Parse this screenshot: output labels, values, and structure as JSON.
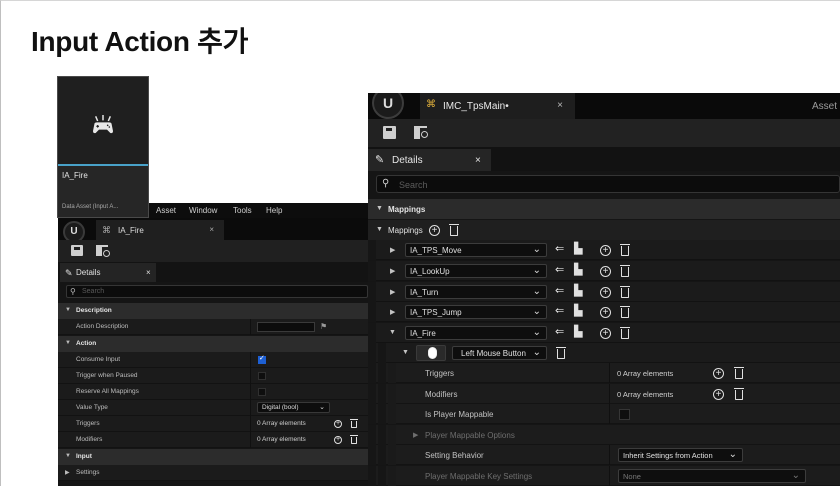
{
  "slide": {
    "title": "Input Action 추가"
  },
  "asset_tile": {
    "name": "IA_Fire",
    "type": "Data Asset (Input A..."
  },
  "left_editor": {
    "menu": [
      "Asset",
      "Window",
      "Tools",
      "Help"
    ],
    "tab_label": "IA_Fire",
    "tab_close": "×",
    "details_label": "Details",
    "details_close": "×",
    "search_placeholder": "Search",
    "rows": {
      "description_header": "Description",
      "action_description": "Action Description",
      "action_header": "Action",
      "consume_input": "Consume Input",
      "trigger_when_paused": "Trigger when Paused",
      "reserve_all_mappings": "Reserve All Mappings",
      "value_type": "Value Type",
      "value_type_value": "Digital (bool)",
      "triggers": "Triggers",
      "triggers_value": "0 Array elements",
      "modifiers": "Modifiers",
      "modifiers_value": "0 Array elements",
      "input_header": "Input",
      "settings": "Settings"
    }
  },
  "right_editor": {
    "tab_label": "IMC_TpsMain•",
    "tab_close": "×",
    "asset_menu": "Asset",
    "details_label": "Details",
    "details_close": "×",
    "search_placeholder": "Search",
    "mappings_category": "Mappings",
    "mappings_label": "Mappings",
    "actions": [
      "IA_TPS_Move",
      "IA_LookUp",
      "IA_Turn",
      "IA_TPS_Jump",
      "IA_Fire"
    ],
    "key_label": "Left Mouse Button",
    "props": {
      "triggers": "Triggers",
      "triggers_value": "0 Array elements",
      "modifiers": "Modifiers",
      "modifiers_value": "0 Array elements",
      "is_player_mappable": "Is Player Mappable",
      "player_mappable_options": "Player Mappable Options",
      "setting_behavior": "Setting Behavior",
      "setting_behavior_value": "Inherit Settings from Action",
      "player_mappable_key_settings": "Player Mappable Key Settings",
      "player_mappable_key_settings_value": "None"
    }
  },
  "icons": {
    "caret_down": "▼",
    "caret_right": "▶",
    "chevron": "⌄",
    "plus": "+",
    "search": "⚲",
    "pencil": "✎",
    "flag": "⚑",
    "use_selected": "⇐",
    "browse": "▙",
    "data_asset": "⌘"
  },
  "colors": {
    "accent_blue": "#1d5fd3",
    "tile_accent": "#49a2c9",
    "imc_icon": "#e3b23c"
  }
}
